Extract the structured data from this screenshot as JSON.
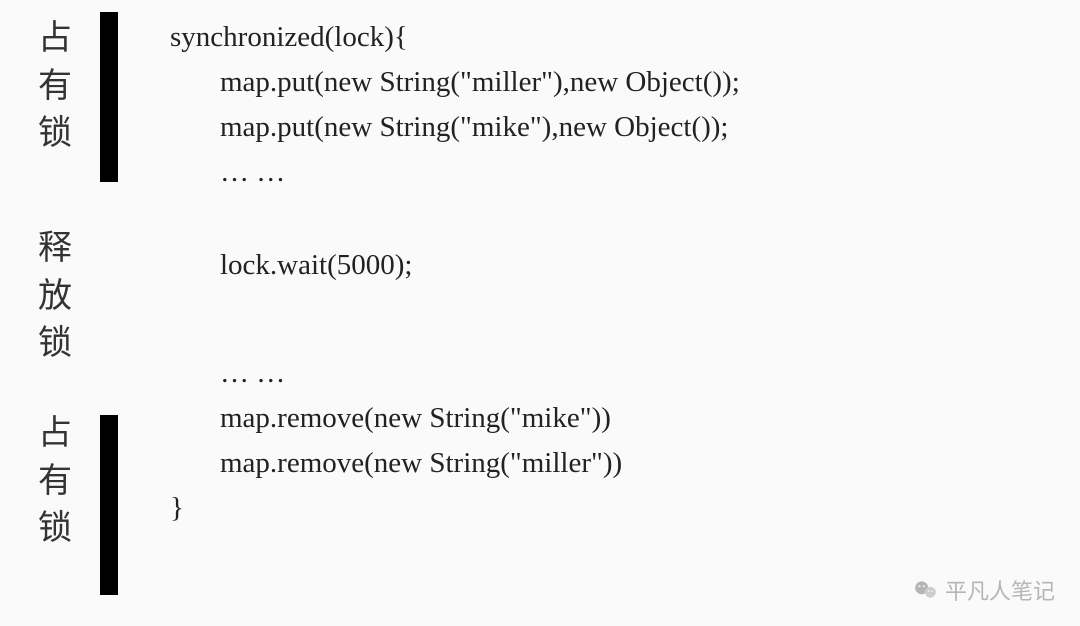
{
  "labels": {
    "section1": [
      "占",
      "有",
      "锁"
    ],
    "section2": [
      "释",
      "放",
      "锁"
    ],
    "section3": [
      "占",
      "有",
      "锁"
    ]
  },
  "code": {
    "line1": "synchronized(lock){",
    "line2": "map.put(new String(\"miller\"),new Object());",
    "line3": "map.put(new String(\"mike\"),new Object());",
    "line4": "… …",
    "line5": "lock.wait(5000);",
    "line6": "… …",
    "line7": "map.remove(new String(\"mike\"))",
    "line8": "map.remove(new String(\"miller\"))",
    "line9": "}"
  },
  "watermark": {
    "text": "平凡人笔记"
  }
}
